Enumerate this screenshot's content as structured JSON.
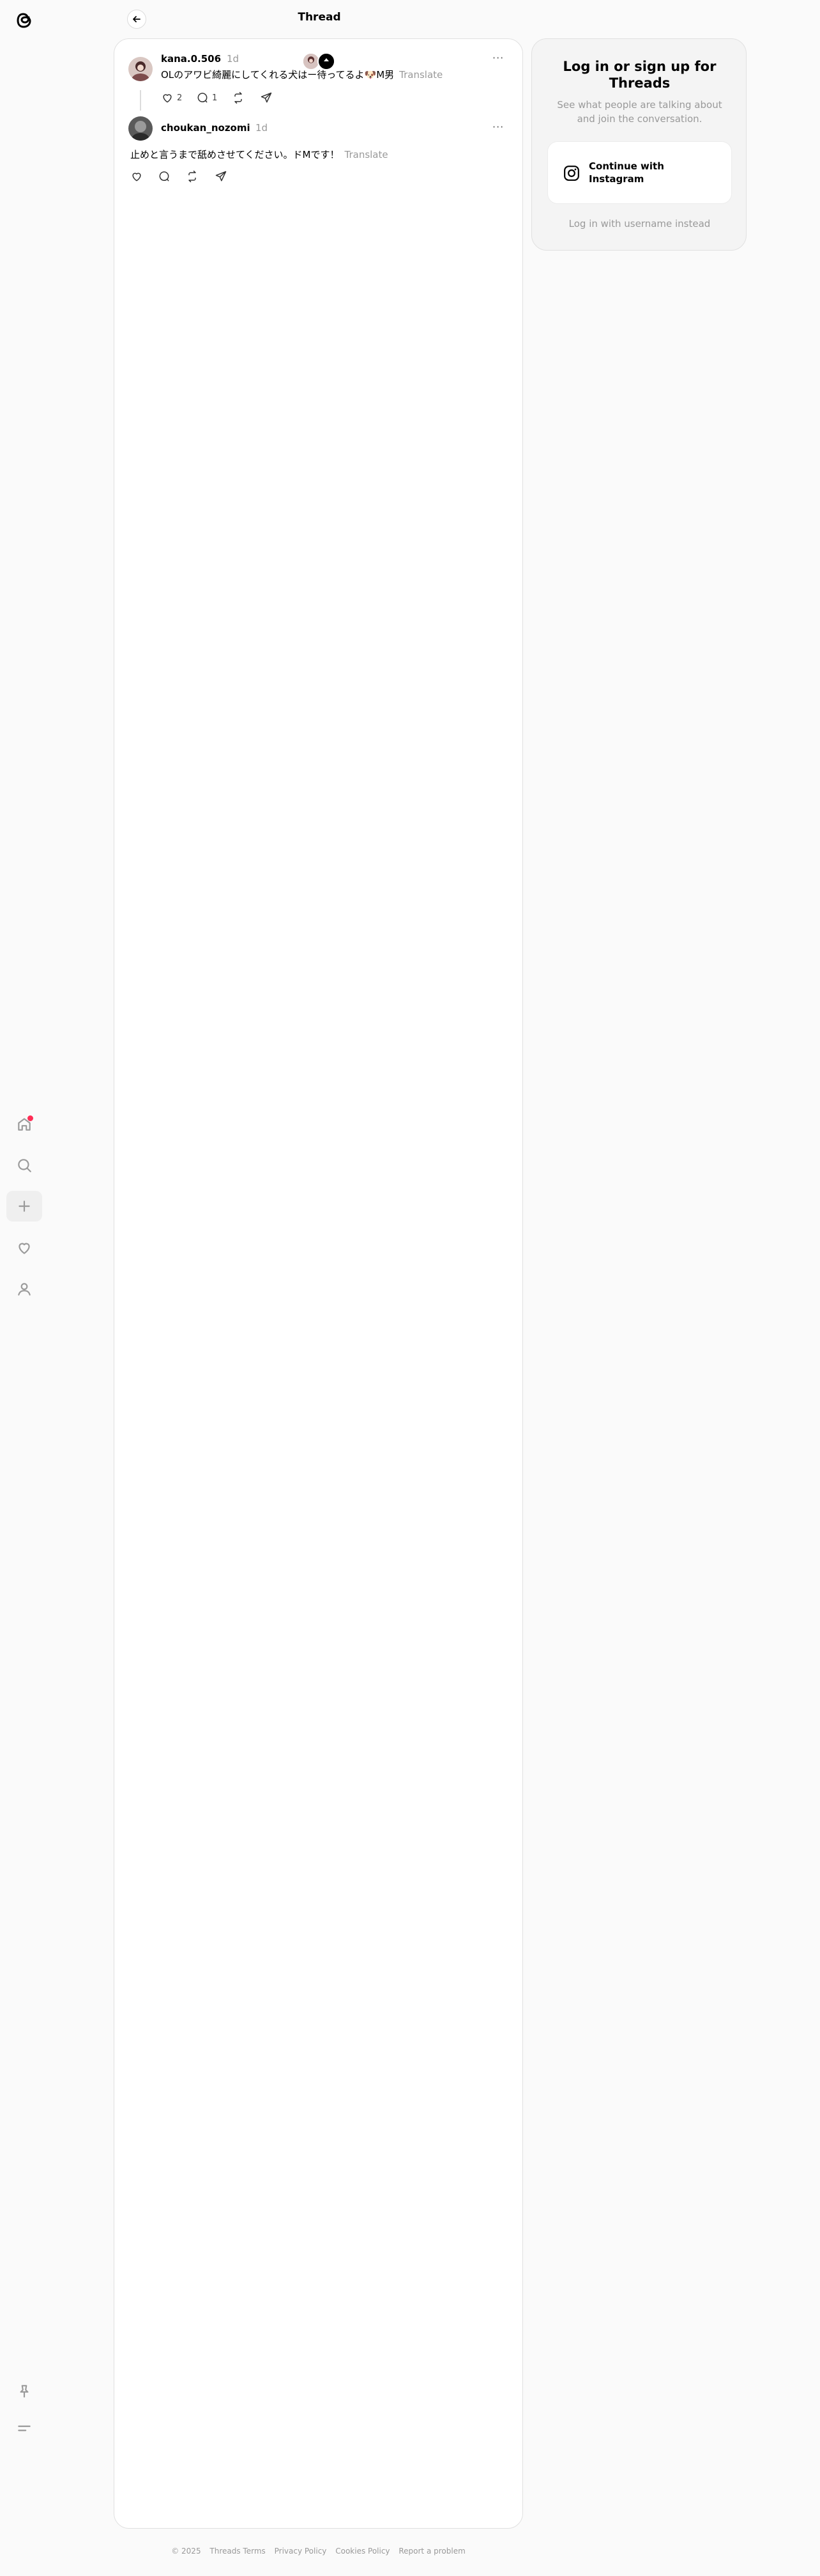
{
  "header": {
    "title": "Thread"
  },
  "nav": {
    "items": [
      "home-icon",
      "search-icon",
      "create-icon",
      "activity-icon",
      "profile-icon"
    ],
    "bottom": [
      "pin-icon",
      "menu-icon"
    ]
  },
  "posts": [
    {
      "username": "kana.0.506",
      "time": "1d",
      "text": "OLのアワビ綺麗にしてくれる犬はー待ってるよ🐶M男",
      "translate": "Translate",
      "likes": "2",
      "replies": "1"
    },
    {
      "username": "choukan_nozomi",
      "time": "1d",
      "text": "止めと言うまで舐めさせてください。ドMです！",
      "translate": "Translate"
    }
  ],
  "login": {
    "title": "Log in or sign up for Threads",
    "subtitle": "See what people are talking about and join the conversation.",
    "instagram_button": "Continue with Instagram",
    "username_link": "Log in with username instead"
  },
  "footer": [
    "© 2025",
    "Threads Terms",
    "Privacy Policy",
    "Cookies Policy",
    "Report a problem"
  ],
  "colors": {
    "notification_dot": "#ff2d55",
    "muted_text": "#999999"
  }
}
